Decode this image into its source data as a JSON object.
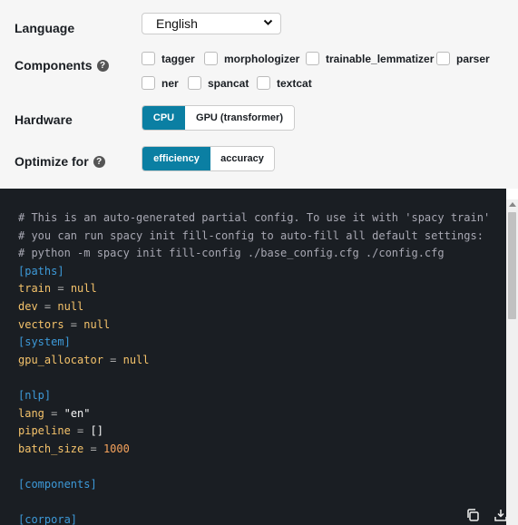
{
  "labels": {
    "language": "Language",
    "components": "Components",
    "hardware": "Hardware",
    "optimize": "Optimize for"
  },
  "help_icon": "?",
  "language_select": {
    "value": "English"
  },
  "components": [
    "tagger",
    "morphologizer",
    "trainable_lemmatizer",
    "parser",
    "ner",
    "spancat",
    "textcat"
  ],
  "hardware": {
    "options": [
      "CPU",
      "GPU (transformer)"
    ],
    "selected": "CPU"
  },
  "optimize": {
    "options": [
      "efficiency",
      "accuracy"
    ],
    "selected": "efficiency"
  },
  "code_lines": [
    [
      {
        "t": "# This is an auto-generated partial config. To use it with 'spacy train'",
        "c": "comment"
      }
    ],
    [
      {
        "t": "# you can run spacy init fill-config to auto-fill all default settings:",
        "c": "comment"
      }
    ],
    [
      {
        "t": "# python -m spacy init fill-config ./base_config.cfg ./config.cfg",
        "c": "comment"
      }
    ],
    [
      {
        "t": "[paths]",
        "c": "section"
      }
    ],
    [
      {
        "t": "train",
        "c": "key"
      },
      {
        "t": " = ",
        "c": "eq"
      },
      {
        "t": "null",
        "c": "key"
      }
    ],
    [
      {
        "t": "dev",
        "c": "key"
      },
      {
        "t": " = ",
        "c": "eq"
      },
      {
        "t": "null",
        "c": "key"
      }
    ],
    [
      {
        "t": "vectors",
        "c": "key"
      },
      {
        "t": " = ",
        "c": "eq"
      },
      {
        "t": "null",
        "c": "key"
      }
    ],
    [
      {
        "t": "[system]",
        "c": "section"
      }
    ],
    [
      {
        "t": "gpu_allocator",
        "c": "key"
      },
      {
        "t": " = ",
        "c": "eq"
      },
      {
        "t": "null",
        "c": "key"
      }
    ],
    [],
    [
      {
        "t": "[nlp]",
        "c": "section"
      }
    ],
    [
      {
        "t": "lang",
        "c": "key"
      },
      {
        "t": " = ",
        "c": "eq"
      },
      {
        "t": "\"en\"",
        "c": "val"
      }
    ],
    [
      {
        "t": "pipeline",
        "c": "key"
      },
      {
        "t": " = ",
        "c": "eq"
      },
      {
        "t": "[]",
        "c": "val"
      }
    ],
    [
      {
        "t": "batch_size",
        "c": "key"
      },
      {
        "t": " = ",
        "c": "eq"
      },
      {
        "t": "1000",
        "c": "num"
      }
    ],
    [],
    [
      {
        "t": "[components]",
        "c": "section"
      }
    ],
    [],
    [
      {
        "t": "[corpora]",
        "c": "section"
      }
    ]
  ],
  "icons": {
    "copy": "copy-icon",
    "download": "download-icon",
    "help": "help-icon",
    "dropdown": "chevron-down-icon"
  },
  "colors": {
    "accent": "#0b7fa3",
    "code_bg": "#1a1e23",
    "key": "#f5c36b",
    "section": "#3d9ad9",
    "number": "#f5a25c"
  }
}
